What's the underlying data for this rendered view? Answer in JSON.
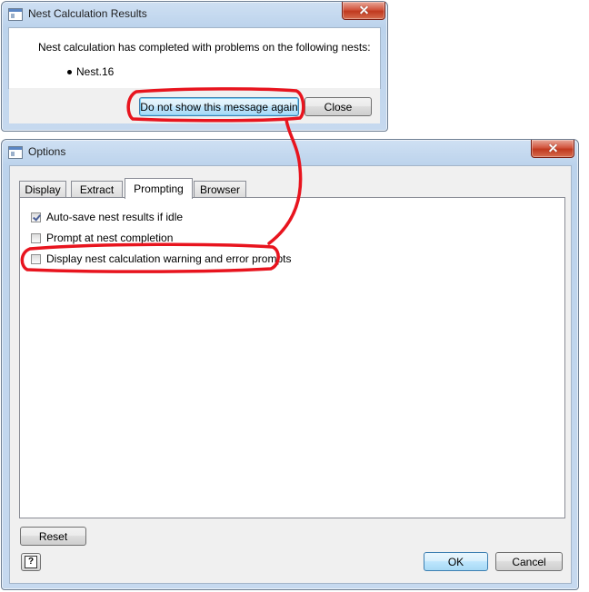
{
  "nest_results_dialog": {
    "title": "Nest Calculation Results",
    "message": "Nest calculation has completed with problems on the following nests:",
    "nests": [
      "Nest.16"
    ],
    "dont_show_label": "Do not show this message again",
    "close_label": "Close"
  },
  "options_dialog": {
    "title": "Options",
    "tabs": [
      {
        "label": "Display",
        "active": false
      },
      {
        "label": "Extract",
        "active": false
      },
      {
        "label": "Prompting",
        "active": true
      },
      {
        "label": "Browser",
        "active": false
      }
    ],
    "checkboxes": [
      {
        "label": "Auto-save nest results if idle",
        "checked": true
      },
      {
        "label": "Prompt at nest completion",
        "checked": false
      },
      {
        "label": "Display nest calculation warning and error prompts",
        "checked": false
      }
    ],
    "reset_label": "Reset",
    "help_glyph": "?",
    "ok_label": "OK",
    "cancel_label": "Cancel"
  },
  "annotation": {
    "color": "#e8141e"
  }
}
